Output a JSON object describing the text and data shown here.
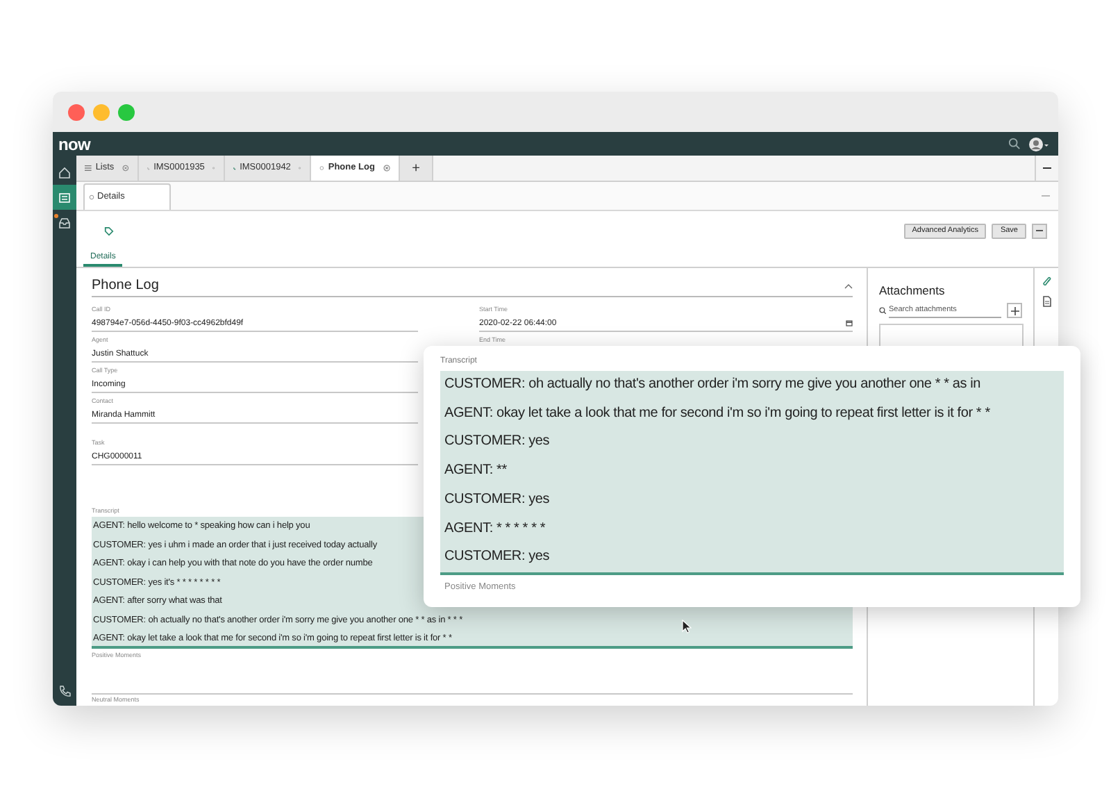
{
  "window": {
    "controls": [
      {
        "color": "#ff5f57"
      },
      {
        "color": "#febc2e"
      },
      {
        "color": "#28c840"
      }
    ]
  },
  "nav": {
    "logo": "now"
  },
  "rail": [
    {
      "kind": "home",
      "selected": false
    },
    {
      "kind": "list",
      "selected": true
    },
    {
      "kind": "inbox",
      "selected": false,
      "badge": true
    }
  ],
  "tabs": [
    {
      "label": "Lists",
      "kind": "list",
      "selected": false
    },
    {
      "label": "IMS0001935",
      "kind": "call",
      "selected": false
    },
    {
      "label": "IMS0001942",
      "kind": "call-active",
      "selected": false
    },
    {
      "label": "Phone Log",
      "kind": "record",
      "selected": true
    },
    {
      "label": "+",
      "kind": "add",
      "selected": false
    }
  ],
  "subtabs": [
    {
      "label": "Details",
      "selected": true
    }
  ],
  "toolbar": {
    "buttons": [
      "Advanced Analytics",
      "Save"
    ]
  },
  "section_tabs": [
    {
      "label": "Details",
      "selected": true
    }
  ],
  "form": {
    "title": "Phone Log",
    "left_fields": [
      {
        "label": "Call ID",
        "value": "498794e7-056d-4450-9f03-cc4962bfd49f"
      },
      {
        "label": "Agent",
        "value": "Justin Shattuck"
      },
      {
        "label": "Call Type",
        "value": "Incoming"
      },
      {
        "label": "Contact",
        "value": "Miranda Hammitt"
      },
      {
        "label": "Task",
        "value": "CHG0000011"
      }
    ],
    "right_fields": [
      {
        "label": "Start Time",
        "value": "2020-02-22 06:44:00"
      },
      {
        "label": "End Time"
      }
    ],
    "transcript": {
      "label": "Transcript",
      "lines": [
        "AGENT: hello welcome to * speaking how can i help you",
        "CUSTOMER: yes i uhm i made an order that i just received today actually",
        "AGENT: okay i can help you with that note do you have the order numbe",
        "CUSTOMER: yes it's * * * * * * * *",
        "AGENT: after sorry what was that",
        "CUSTOMER: oh actually no that's another order i'm sorry me give you another one * * as in * * *",
        "AGENT: okay let take a look that me for second i'm so i'm going to repeat first letter is it for * *"
      ]
    },
    "positive_label": "Positive Moments",
    "neutral_label": "Neutral Moments"
  },
  "attachments": {
    "title": "Attachments",
    "placeholder": "Search attachments"
  },
  "popup": {
    "label": "Transcript",
    "lines": [
      "CUSTOMER: oh actually no that's another order i'm sorry me give you another one * * as in",
      "AGENT: okay let take a look that me for second i'm so i'm going to repeat first letter is it for * *",
      "CUSTOMER: yes",
      "AGENT: **",
      "CUSTOMER: yes",
      "AGENT: * * * * * *",
      "CUSTOMER: yes"
    ],
    "footer_label": "Positive Moments"
  }
}
